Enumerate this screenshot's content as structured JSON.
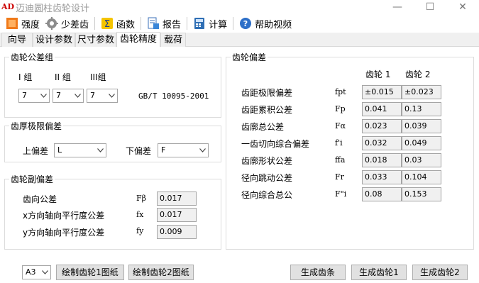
{
  "window": {
    "title": "迈迪圆柱齿轮设计",
    "min": "—",
    "max": "☐",
    "close": "✕"
  },
  "toolbar": {
    "strength": "强度",
    "few_teeth": "少差齿",
    "function": "函数",
    "report": "报告",
    "calculate": "计算",
    "help_video": "帮助视频"
  },
  "tabs": [
    "向导",
    "设计参数",
    "尺寸参数",
    "齿轮精度",
    "载荷"
  ],
  "tolerance_group": {
    "title": "齿轮公差组",
    "headers": [
      "I 组",
      "II 组",
      "III组"
    ],
    "values": [
      "7",
      "7",
      "7"
    ],
    "standard": "GB/T 10095-2001"
  },
  "thickness": {
    "title": "齿厚极限偏差",
    "upper_label": "上偏差",
    "upper_value": "L",
    "lower_label": "下偏差",
    "lower_value": "F"
  },
  "pair": {
    "title": "齿轮副偏差",
    "rows": [
      {
        "label": "齿向公差",
        "symbol": "Fβ",
        "value": "0.017"
      },
      {
        "label": "x方向轴向平行度公差",
        "symbol": "fx",
        "value": "0.017"
      },
      {
        "label": "y方向轴向平行度公差",
        "symbol": "fy",
        "value": "0.009"
      }
    ]
  },
  "deviation": {
    "title": "齿轮偏差",
    "col1": "齿轮 1",
    "col2": "齿轮 2",
    "rows": [
      {
        "label": "齿距极限偏差",
        "symbol": "fpt",
        "g1": "±0.015",
        "g2": "±0.023"
      },
      {
        "label": "齿距累积公差",
        "symbol": "Fp",
        "g1": "0.041",
        "g2": "0.13"
      },
      {
        "label": "齿廓总公差",
        "symbol": "Fα",
        "g1": "0.023",
        "g2": "0.039"
      },
      {
        "label": "一齿切向综合偏差",
        "symbol": "f'i",
        "g1": "0.032",
        "g2": "0.049"
      },
      {
        "label": "齿廓形状公差",
        "symbol": "ffa",
        "g1": "0.018",
        "g2": "0.03"
      },
      {
        "label": "径向跳动公差",
        "symbol": "Fr",
        "g1": "0.033",
        "g2": "0.104"
      },
      {
        "label": "径向综合总公",
        "symbol": "F\"i",
        "g1": "0.08",
        "g2": "0.153"
      }
    ]
  },
  "bottom": {
    "paper": "A3",
    "draw1": "绘制齿轮1图纸",
    "draw2": "绘制齿轮2图纸",
    "gen_pair": "生成齿条",
    "gen1": "生成齿轮1",
    "gen2": "生成齿轮2"
  }
}
